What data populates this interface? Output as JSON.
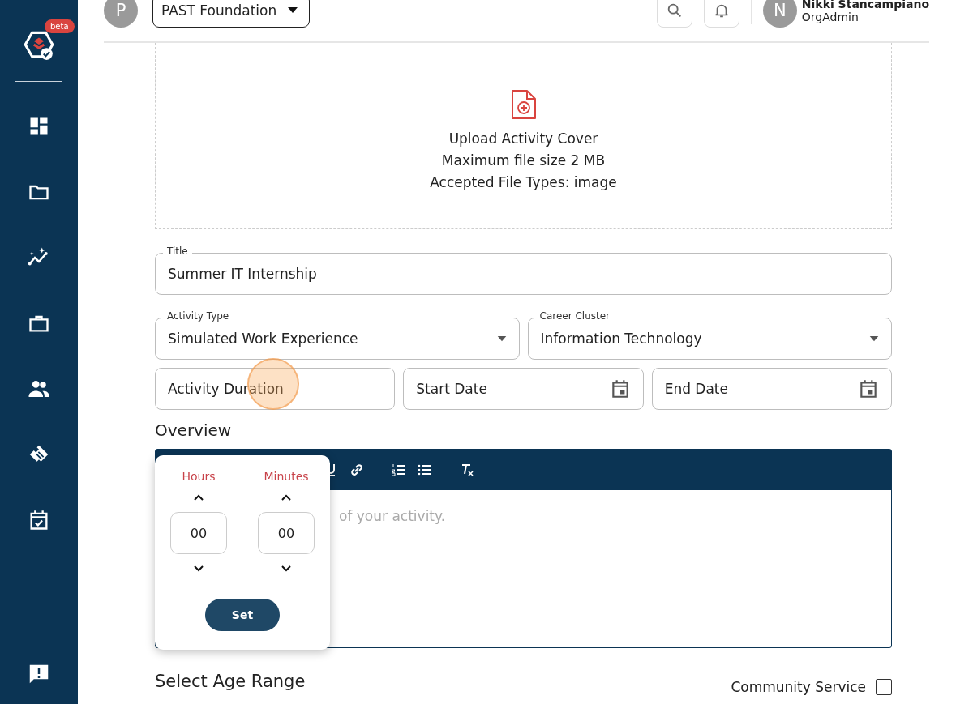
{
  "sidebar": {
    "badge": "beta"
  },
  "header": {
    "org_avatar": "P",
    "org_name": "PAST Foundation",
    "user_avatar": "N",
    "user_name": "Nikki Stancampiano",
    "user_role": "OrgAdmin"
  },
  "upload": {
    "title": "Upload Activity Cover",
    "size_note": "Maximum file size 2 MB",
    "types_note": "Accepted File Types: image"
  },
  "fields": [
    {
      "kind": "text",
      "label": "Title",
      "value": "Summer IT Internship"
    }
  ],
  "selects": [
    {
      "label": "Activity Type",
      "value": "Simulated Work Experience"
    },
    {
      "label": "Career Cluster",
      "value": "Information Technology"
    }
  ],
  "duration": {
    "placeholder": "Activity Duration"
  },
  "dates": [
    {
      "placeholder": "Start Date"
    },
    {
      "placeholder": "End Date"
    }
  ],
  "overview": {
    "heading": "Overview",
    "placeholder": "of your activity."
  },
  "duration_picker": {
    "columns": [
      {
        "label": "Hours",
        "value": "00"
      },
      {
        "label": "Minutes",
        "value": "00"
      }
    ],
    "button": "Set"
  },
  "age_range": {
    "heading": "Select Age Range"
  },
  "community_service": {
    "label": "Community Service",
    "checked": false
  }
}
